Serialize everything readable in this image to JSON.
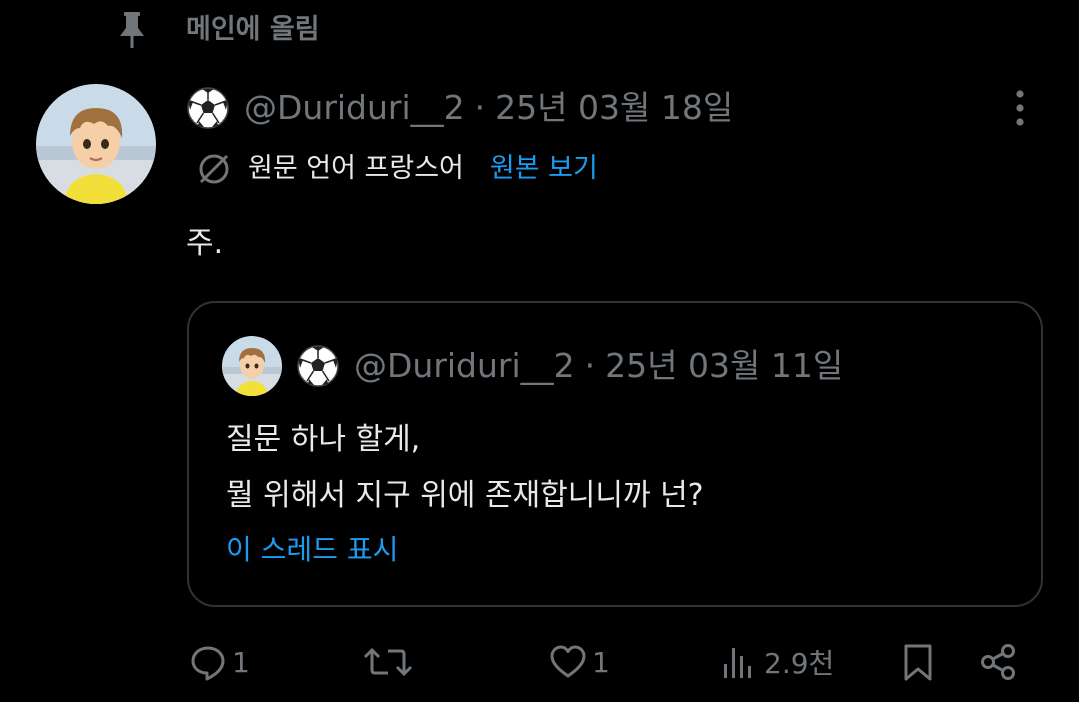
{
  "pinned": {
    "label": "메인에 올림"
  },
  "post": {
    "handle": "@Duriduri__2",
    "separator": "·",
    "date": "25년 03월 18일",
    "translation": {
      "source_label": "원문 언어 프랑스어",
      "show_original": "원본 보기"
    },
    "text": "주."
  },
  "quote": {
    "handle": "@Duriduri__2",
    "separator": "·",
    "date": "25년 03월 11일",
    "lines": [
      "질문 하나 할게,",
      "뭘 위해서 지구 위에 존재합니니까 넌?"
    ],
    "show_thread": "이 스레드 표시"
  },
  "actions": {
    "replies": "1",
    "retweets": "",
    "likes": "1",
    "views": "2.9천"
  },
  "colors": {
    "background": "#000000",
    "text_primary": "#e7e9ea",
    "text_secondary": "#71767b",
    "accent": "#1d9bf0",
    "border": "#2f3336"
  },
  "icons": {
    "pin": "pin-icon",
    "soccer": "soccer-ball-icon",
    "more": "more-vertical-icon",
    "translate": "globe-slash-icon",
    "reply": "reply-icon",
    "retweet": "retweet-icon",
    "like": "heart-icon",
    "views": "views-icon",
    "bookmark": "bookmark-icon",
    "share": "share-icon"
  }
}
